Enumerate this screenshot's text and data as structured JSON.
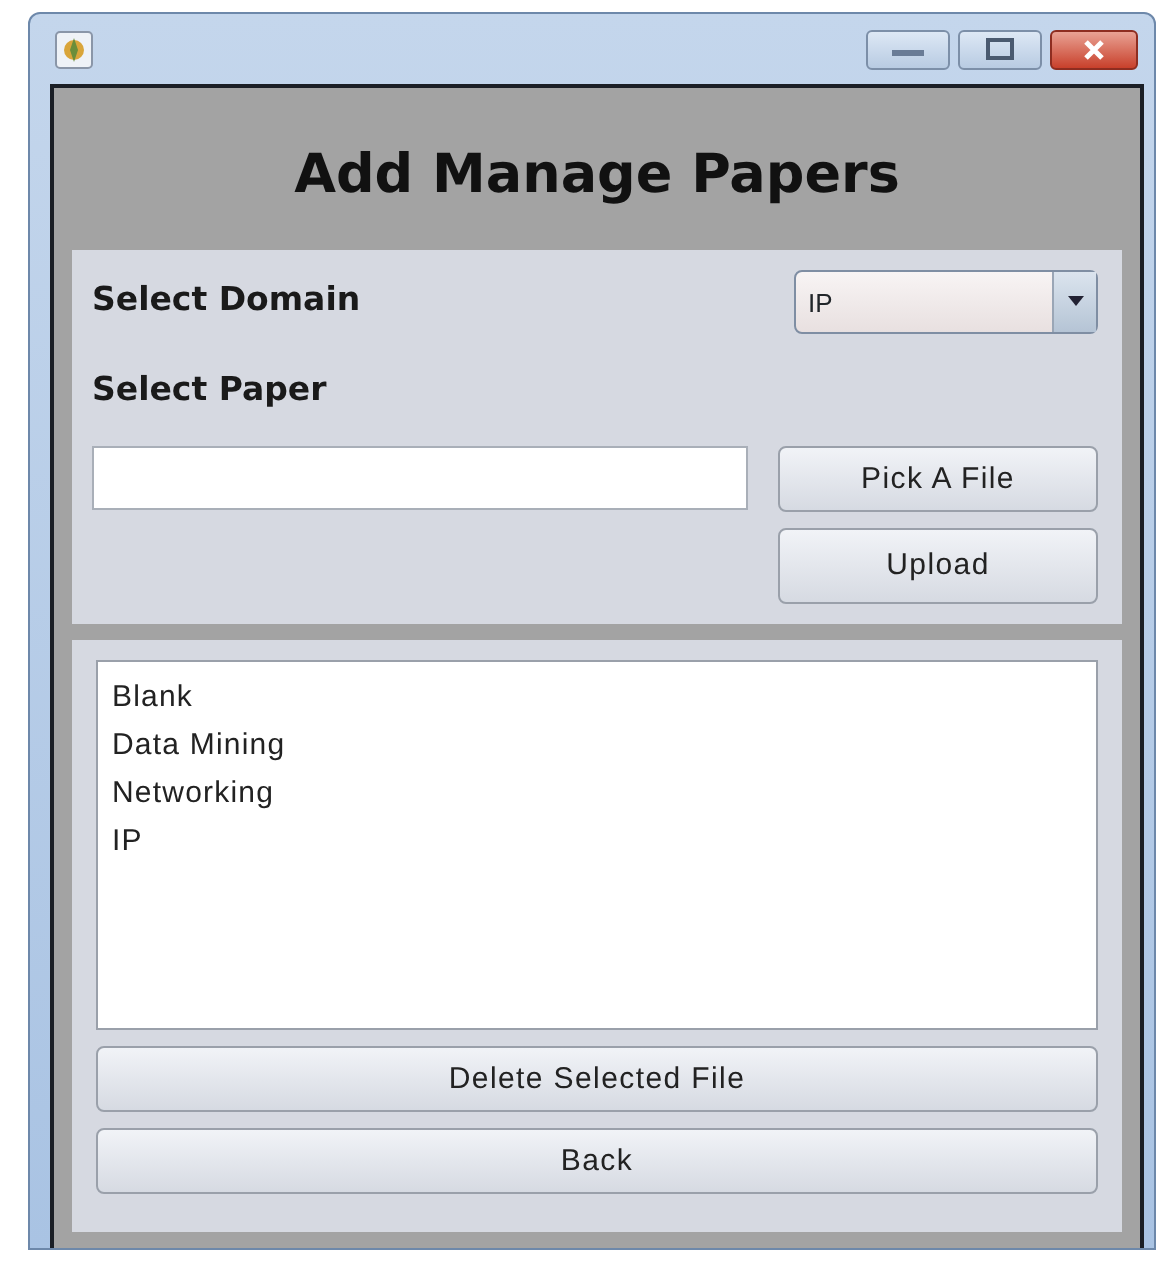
{
  "header": {
    "title": "Add Manage Papers"
  },
  "form": {
    "domain_label": "Select Domain",
    "domain_value": "IP",
    "paper_label": "Select Paper",
    "pick_button": "Pick A File",
    "upload_button": "Upload"
  },
  "papers": {
    "items": [
      {
        "label": "Blank"
      },
      {
        "label": "Data Mining"
      },
      {
        "label": "Networking"
      },
      {
        "label": "IP"
      }
    ],
    "delete_button": "Delete Selected File",
    "back_button": "Back"
  }
}
